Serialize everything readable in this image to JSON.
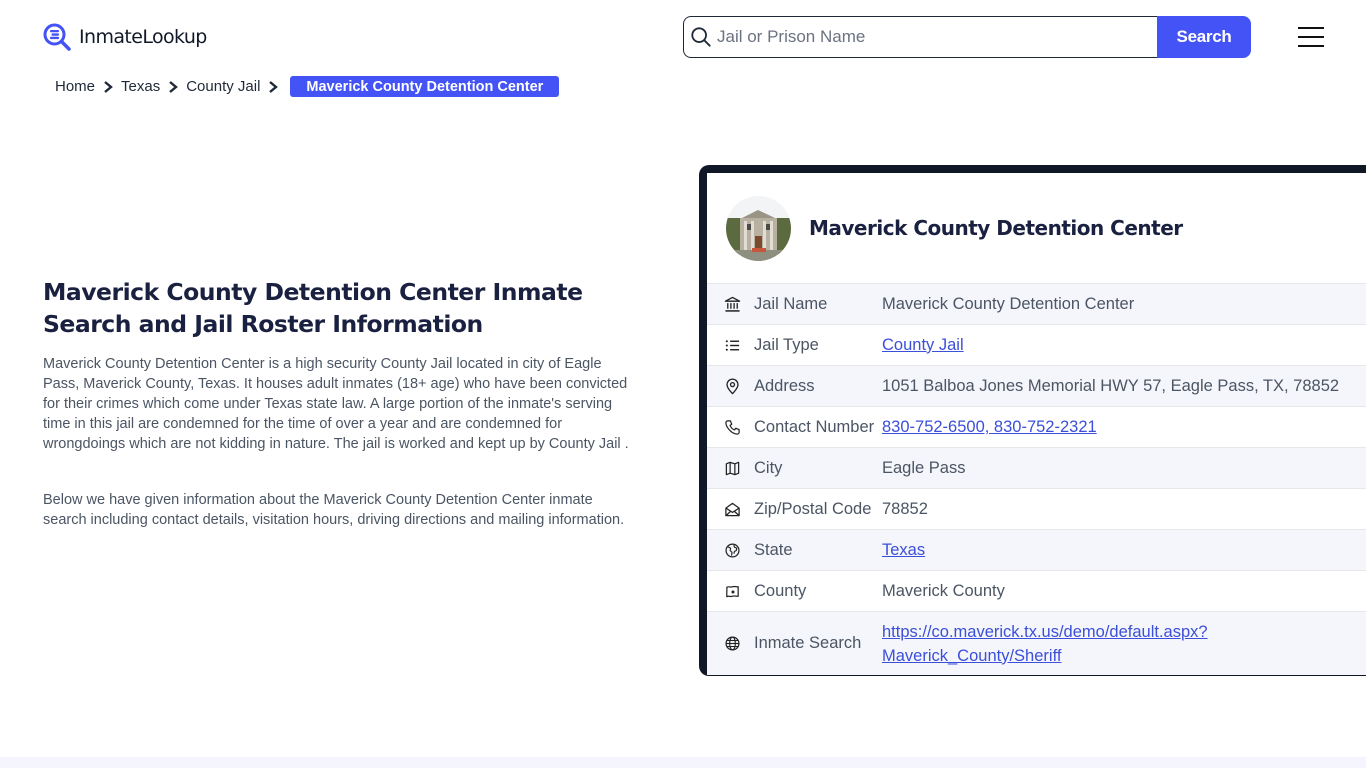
{
  "header": {
    "logo_text": "InmateLookup",
    "search_placeholder": "Jail or Prison Name",
    "search_value": "",
    "search_button": "Search"
  },
  "breadcrumb": {
    "items": [
      "Home",
      "Texas",
      "County Jail"
    ],
    "current": "Maverick County Detention Center"
  },
  "main": {
    "title": "Maverick County Detention Center Inmate Search and Jail Roster Information",
    "paragraphs": [
      "Maverick County Detention Center is a high security County Jail located in city of Eagle Pass, Maverick County, Texas. It houses adult inmates (18+ age) who have been convicted for their crimes which come under Texas state law. A large portion of the inmate's serving time in this jail are condemned for the time of over a year and are condemned for wrongdoings which are not kidding in nature. The jail is worked and kept up by County Jail .",
      "Below we have given information about the Maverick County Detention Center inmate search including contact details, visitation hours, driving directions and mailing information."
    ]
  },
  "card": {
    "title": "Maverick County Detention Center",
    "colors": {
      "border": "#101828",
      "accent": "#4353f5",
      "link": "#3b4fd8"
    },
    "rows": [
      {
        "icon": "bank-icon",
        "label": "Jail Name",
        "value": "Maverick County Detention Center",
        "link": false
      },
      {
        "icon": "list-icon",
        "label": "Jail Type",
        "value": "County Jail",
        "link": true
      },
      {
        "icon": "map-pin-icon",
        "label": "Address",
        "value": "1051 Balboa Jones Memorial HWY 57, Eagle Pass, TX, 78852",
        "link": false
      },
      {
        "icon": "phone-icon",
        "label": "Contact Number",
        "value": "830-752-6500, 830-752-2321",
        "link": true
      },
      {
        "icon": "map-icon",
        "label": "City",
        "value": "Eagle Pass",
        "link": false
      },
      {
        "icon": "mail-open-icon",
        "label": "Zip/Postal Code",
        "value": "78852",
        "link": false
      },
      {
        "icon": "world-icon",
        "label": "State",
        "value": "Texas",
        "link": true
      },
      {
        "icon": "map-pin-square-icon",
        "label": "County",
        "value": "Maverick County",
        "link": false
      },
      {
        "icon": "globe-icon",
        "label": "Inmate Search",
        "value": "https://co.maverick.tx.us/demo/default.aspx?",
        "value_line2": "Maverick_County/Sheriff",
        "link": true
      }
    ]
  }
}
